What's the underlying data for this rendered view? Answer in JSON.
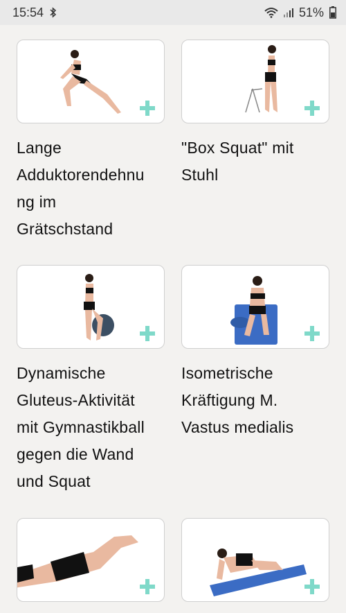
{
  "status_bar": {
    "time": "15:54",
    "battery": "51%",
    "icons": [
      "bluetooth-icon",
      "wifi-icon",
      "signal-icon",
      "battery-icon"
    ]
  },
  "accent_color": "#7fd9c9",
  "exercises": [
    {
      "title": "Lange\nAdduktorendehnu\nng im\nGrätschstand",
      "icon": "add-plus-icon"
    },
    {
      "title": "\"Box Squat\" mit\nStuhl",
      "icon": "add-plus-icon"
    },
    {
      "title": "Dynamische\nGluteus-Aktivität\nmit Gymnastikball\ngegen die Wand\nund Squat",
      "icon": "add-plus-icon"
    },
    {
      "title": "Isometrische\nKräftigung M.\nVastus medialis",
      "icon": "add-plus-icon"
    },
    {
      "title": "",
      "icon": "add-plus-icon"
    },
    {
      "title": "",
      "icon": "add-plus-icon"
    }
  ]
}
